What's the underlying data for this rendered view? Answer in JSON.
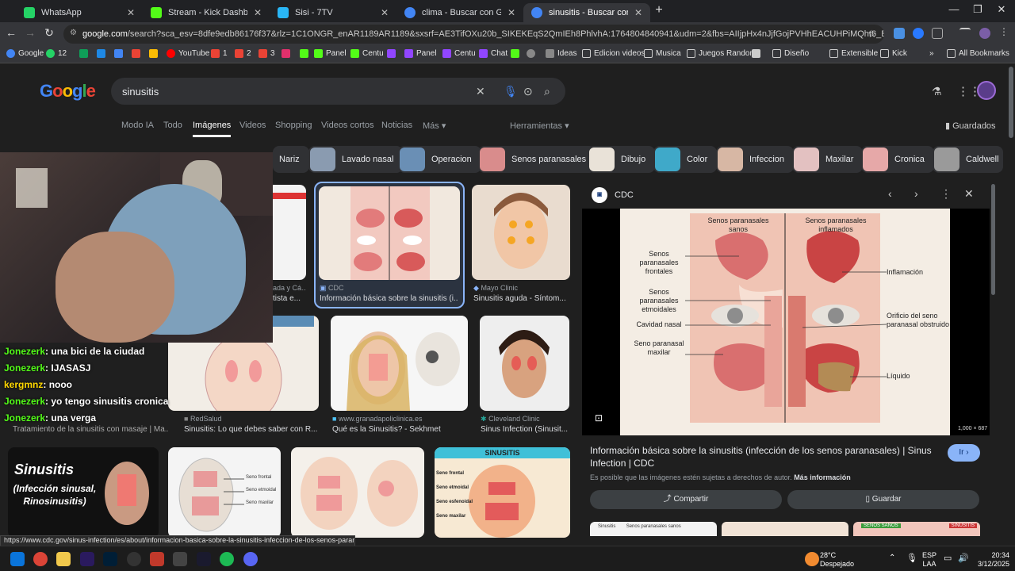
{
  "tabs": [
    {
      "title": "WhatsApp",
      "color": "#25d366"
    },
    {
      "title": "Stream - Kick Dashboard",
      "color": "#53fc18"
    },
    {
      "title": "Sisi - 7TV",
      "color": "#29b6f6"
    },
    {
      "title": "clima - Buscar con Google",
      "color": "#4285f4"
    },
    {
      "title": "sinusitis - Buscar con Google",
      "color": "#4285f4"
    }
  ],
  "new_tab": "+",
  "url_host": "google.com",
  "url_rest": "/search?sca_esv=8dfe9edb86176f37&rlz=1C1ONGR_enAR1189AR1189&sxsrf=AE3TifOXu20b_SIKEKEqS2QmIEh8PhlvhA:1764804840941&udm=2&fbs=AIIjpHx4nJjfGojPVHhEACUHPiMQht6_BFq6vBIoFFRK7qchKEWEvuc0Hbw3...",
  "bookmarks": [
    "Google",
    "12",
    "",
    "",
    "",
    "",
    "",
    "YouTube",
    "1",
    "2",
    "3",
    "",
    "Panel",
    "Centu",
    "",
    "Panel",
    "Centu",
    "Chat",
    "",
    "",
    "Ideas",
    "Edicion videos",
    "Musica",
    "Juegos Random",
    "",
    "Diseño",
    "Extensible",
    "Kick"
  ],
  "all_bookmarks": "All Bookmarks",
  "logo": "Google",
  "search_query": "sinusitis",
  "google_tabs": [
    "Modo IA",
    "Todo",
    "Imágenes",
    "Videos",
    "Shopping",
    "Videos cortos",
    "Noticias",
    "Más"
  ],
  "tools": "Herramientas",
  "saved": "Guardados",
  "chips": [
    "Nariz",
    "Lavado nasal",
    "Operacion",
    "Senos paranasales",
    "Dibujo",
    "Color",
    "Infeccion",
    "Maxilar",
    "Cronica",
    "Caldwell"
  ],
  "results_row1": [
    {
      "src": "ada y Cá...",
      "cap": "tista e..."
    },
    {
      "src": "CDC",
      "cap": "Información básica sobre la sinusitis (i..."
    },
    {
      "src": "Mayo Clinic",
      "cap": "Sinusitis aguda - Síntom..."
    }
  ],
  "results_row2": [
    {
      "src": "",
      "cap": "Tratamiento de la sinusitis con masaje | Ma..."
    },
    {
      "src": "RedSalud",
      "cap": "Sinusitis: Lo que debes saber con R..."
    },
    {
      "src": "www.granadapoliclinica.es",
      "cap": "Qué es la Sinusitis? - Sekhmet"
    },
    {
      "src": "Cleveland Clinic",
      "cap": "Sinus Infection (Sinusit..."
    }
  ],
  "row3_left": {
    "title": "Sinusitis",
    "sub": "(Infección sinusal, Rinosinusitis)"
  },
  "row3_right_title": "SINUSITIS",
  "chat": [
    {
      "user": "Jonezerk",
      "msg": ": una bici de la ciudad"
    },
    {
      "user": "Jonezerk",
      "msg": ": IJASASJ"
    },
    {
      "user": "kergmnz",
      "msg": ": nooo"
    },
    {
      "user": "Jonezerk",
      "msg": ": yo tengo sinusitis cronica"
    },
    {
      "user": "Jonezerk",
      "msg": ": una verga"
    }
  ],
  "panel": {
    "source": "CDC",
    "title": "Información básica sobre la sinusitis (infección de los senos paranasales) | Sinus Infection | CDC",
    "go": "Ir",
    "dims": "1,000 × 687",
    "copyright": "Es posible que las imágenes estén sujetas a derechos de autor.",
    "more": "Más información",
    "share": "Compartir",
    "save": "Guardar",
    "labels": {
      "healthy": "Senos paranasales sanos",
      "inflamed": "Senos paranasales inflamados",
      "frontal": "Senos paranasales frontales",
      "ethmoid": "Senos paranasales etmoidales",
      "nasal": "Cavidad nasal",
      "maxillary": "Seno paranasal maxilar",
      "inflammation": "Inflamación",
      "orifice": "Orificio del seno paranasal obstruido",
      "liquid": "Líquido"
    },
    "bottom_thumbs": [
      "Sinusitis",
      "Senos paranasales sanos",
      "",
      "SENOS SANOS",
      "SINUSITIS"
    ]
  },
  "status_url": "https://www.cdc.gov/sinus-infection/es/about/informacion-basica-sobre-la-sinusitis-infeccion-de-los-senos-paranasales.html",
  "taskbar": {
    "temp": "28°C",
    "weather": "Despejado",
    "lang1": "ESP",
    "lang2": "LAA",
    "time": "20:34",
    "date": "3/12/2025"
  },
  "thumb_labels": {
    "seno_frontal": "Seno frontal",
    "seno_etmoidal": "Seno etmoidal",
    "seno_maxilar": "Seno maxilar",
    "seno_esfenoidal": "Seno esfenoidal"
  }
}
